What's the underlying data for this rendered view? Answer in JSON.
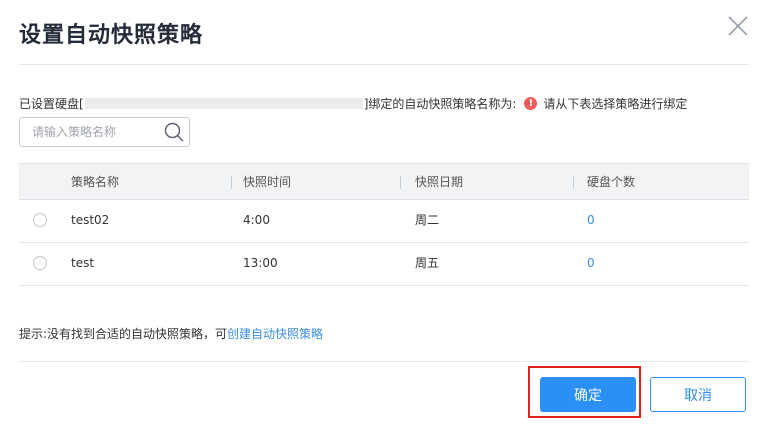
{
  "dialog": {
    "title": "设置自动快照策略"
  },
  "info": {
    "prefix": "已设置硬盘[",
    "suffix": "]绑定的自动快照策略名称为:",
    "warning": "请从下表选择策略进行绑定",
    "warning_icon": "exclamation-circle-icon"
  },
  "search": {
    "placeholder": "请输入策略名称"
  },
  "table": {
    "headers": [
      "策略名称",
      "快照时间",
      "快照日期",
      "硬盘个数"
    ],
    "rows": [
      {
        "name": "test02",
        "time": "4:00",
        "date": "周二",
        "disks": "0",
        "selected": false
      },
      {
        "name": "test",
        "time": "13:00",
        "date": "周五",
        "disks": "0",
        "selected": false
      }
    ]
  },
  "hint": {
    "text": "提示:没有找到合适的自动快照策略，可",
    "link": "创建自动快照策略"
  },
  "footer": {
    "ok_label": "确定",
    "cancel_label": "取消"
  },
  "colors": {
    "primary": "#2a8ff7",
    "link": "#3b8de0",
    "warning": "#f05a5a",
    "highlight": "#e2231a"
  }
}
